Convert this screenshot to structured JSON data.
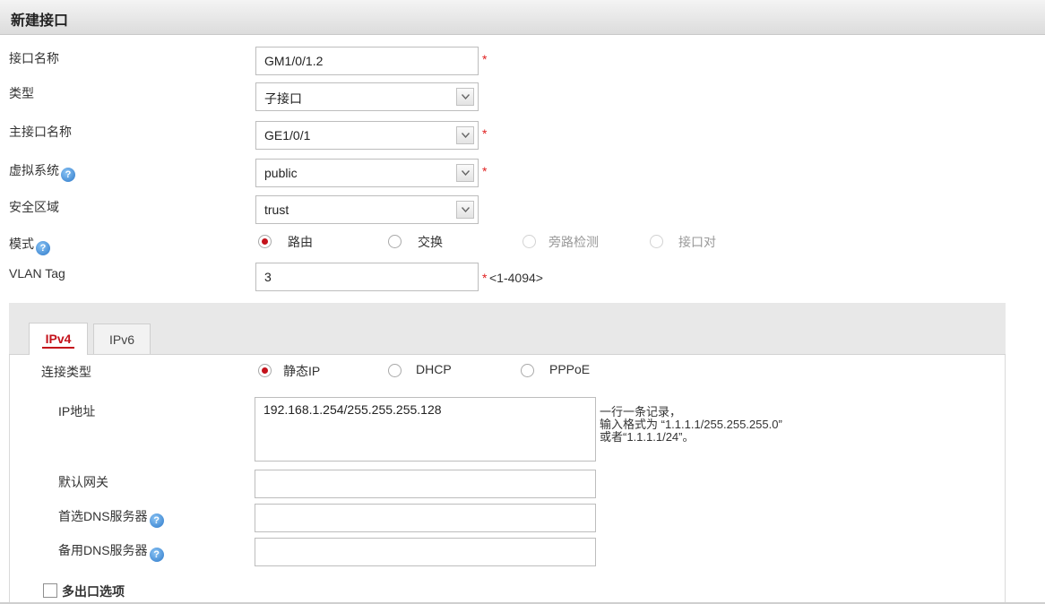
{
  "header": {
    "title": "新建接口"
  },
  "form": {
    "name": {
      "label": "接口名称",
      "value": "GM1/0/1.2",
      "required": "*"
    },
    "type": {
      "label": "类型",
      "value": "子接口"
    },
    "parent": {
      "label": "主接口名称",
      "value": "GE1/0/1",
      "required": "*"
    },
    "vsys": {
      "label": "虚拟系统",
      "value": "public",
      "required": "*"
    },
    "zone": {
      "label": "安全区域",
      "value": "trust"
    },
    "mode": {
      "label": "模式",
      "options": [
        "路由",
        "交换",
        "旁路检测",
        "接口对"
      ],
      "selected": "路由"
    },
    "vlan": {
      "label": "VLAN Tag",
      "value": "3",
      "required": "*",
      "range": "<1-4094>"
    }
  },
  "tabs": [
    {
      "label": "IPv4",
      "active": true
    },
    {
      "label": "IPv6",
      "active": false
    }
  ],
  "ipv4": {
    "conn": {
      "label": "连接类型",
      "options": [
        "静态IP",
        "DHCP",
        "PPPoE"
      ],
      "selected": "静态IP"
    },
    "ip": {
      "label": "IP地址",
      "value": "192.168.1.254/255.255.255.128",
      "hint": [
        "一行一条记录，",
        "输入格式为 “1.1.1.1/255.255.255.0”",
        "或者“1.1.1.1/24”。"
      ]
    },
    "gateway": {
      "label": "默认网关",
      "value": ""
    },
    "dns1": {
      "label": "首选DNS服务器",
      "value": ""
    },
    "dns2": {
      "label": "备用DNS服务器",
      "value": ""
    },
    "multi_exit": {
      "label": "多出口选项",
      "checked": false
    }
  },
  "icons": {
    "help": "help-icon",
    "dropdown": "chevron-down-icon"
  },
  "colors": {
    "accent": "#c4121b",
    "required": "#e02020"
  }
}
